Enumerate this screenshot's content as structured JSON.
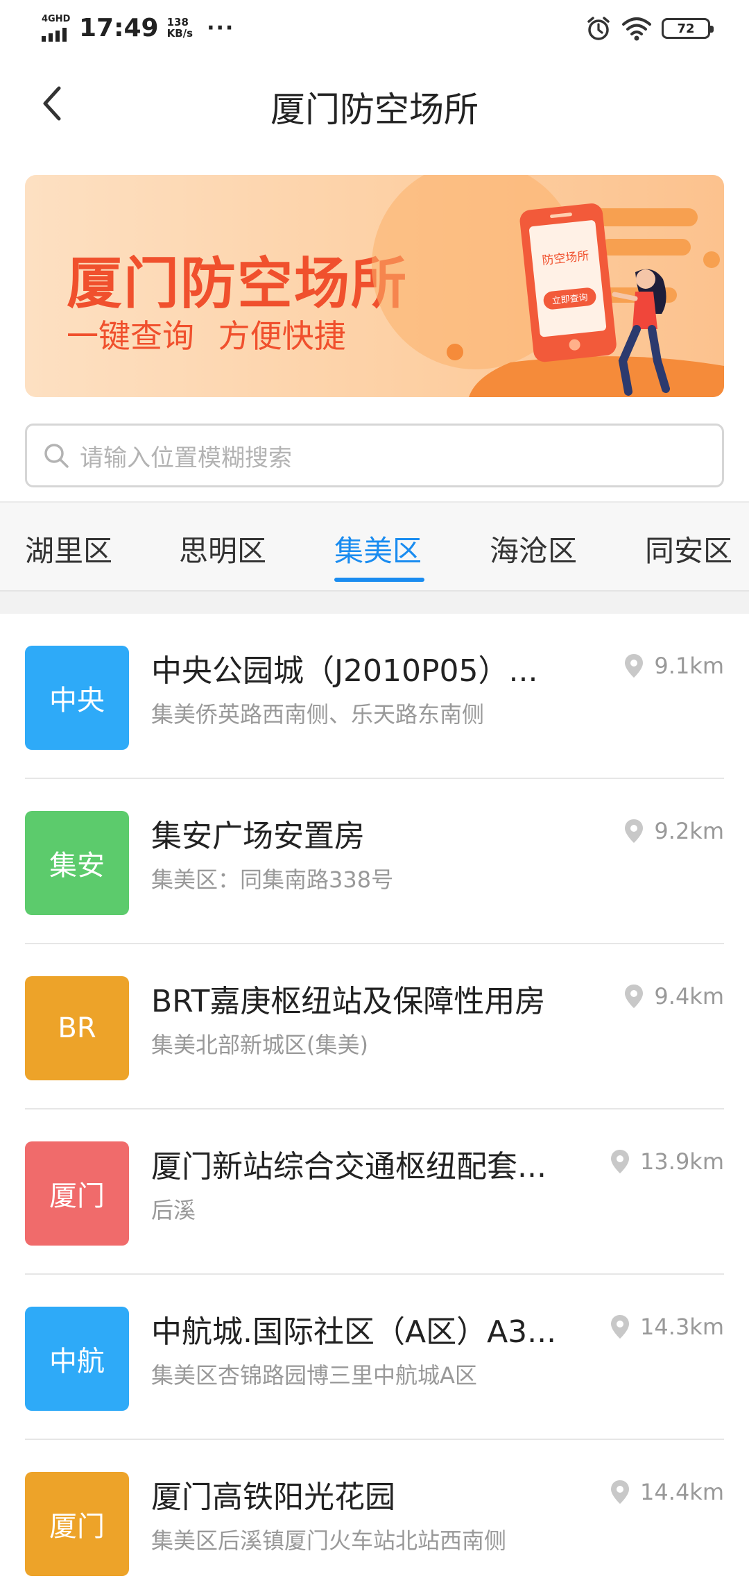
{
  "status_bar": {
    "network": "4GHD",
    "time": "17:49",
    "speed_value": "138",
    "speed_unit": "KB/s",
    "more": "···",
    "battery": "72"
  },
  "header": {
    "title": "厦门防空场所"
  },
  "banner": {
    "title": "厦门防空场所",
    "subtitle": "一键查询  方便快捷",
    "phone_text": "防空场所",
    "phone_button": "立即查询"
  },
  "search": {
    "placeholder": "请输入位置模糊搜索"
  },
  "tabs": [
    {
      "label": "湖里区",
      "active": false
    },
    {
      "label": "思明区",
      "active": false
    },
    {
      "label": "集美区",
      "active": true
    },
    {
      "label": "海沧区",
      "active": false
    },
    {
      "label": "同安区",
      "active": false
    }
  ],
  "colors": {
    "accent": "#1a8cf0",
    "badge_blue": "#2eaaf8",
    "badge_green": "#5ccb6c",
    "badge_orange": "#eda329",
    "badge_red": "#f06b6b",
    "banner_text": "#f0502d"
  },
  "shelters": [
    {
      "badge": "中央",
      "color": "#2eaaf8",
      "name": "中央公园城（J2010P05）...",
      "address": "集美侨英路西南侧、乐天路东南侧",
      "distance": "9.1km"
    },
    {
      "badge": "集安",
      "color": "#5ccb6c",
      "name": "集安广场安置房",
      "address": "集美区：同集南路338号",
      "distance": "9.2km"
    },
    {
      "badge": "BR",
      "color": "#eda329",
      "name": "BRT嘉庚枢纽站及保障性用房",
      "address": "集美北部新城区(集美)",
      "distance": "9.4km"
    },
    {
      "badge": "厦门",
      "color": "#f06b6b",
      "name": "厦门新站综合交通枢纽配套...",
      "address": "后溪",
      "distance": "13.9km"
    },
    {
      "badge": "中航",
      "color": "#2eaaf8",
      "name": "中航城.国际社区（A区）A3...",
      "address": "集美区杏锦路园博三里中航城A区",
      "distance": "14.3km"
    },
    {
      "badge": "厦门",
      "color": "#eda329",
      "name": "厦门高铁阳光花园",
      "address": "集美区后溪镇厦门火车站北站西南侧",
      "distance": "14.4km"
    }
  ]
}
